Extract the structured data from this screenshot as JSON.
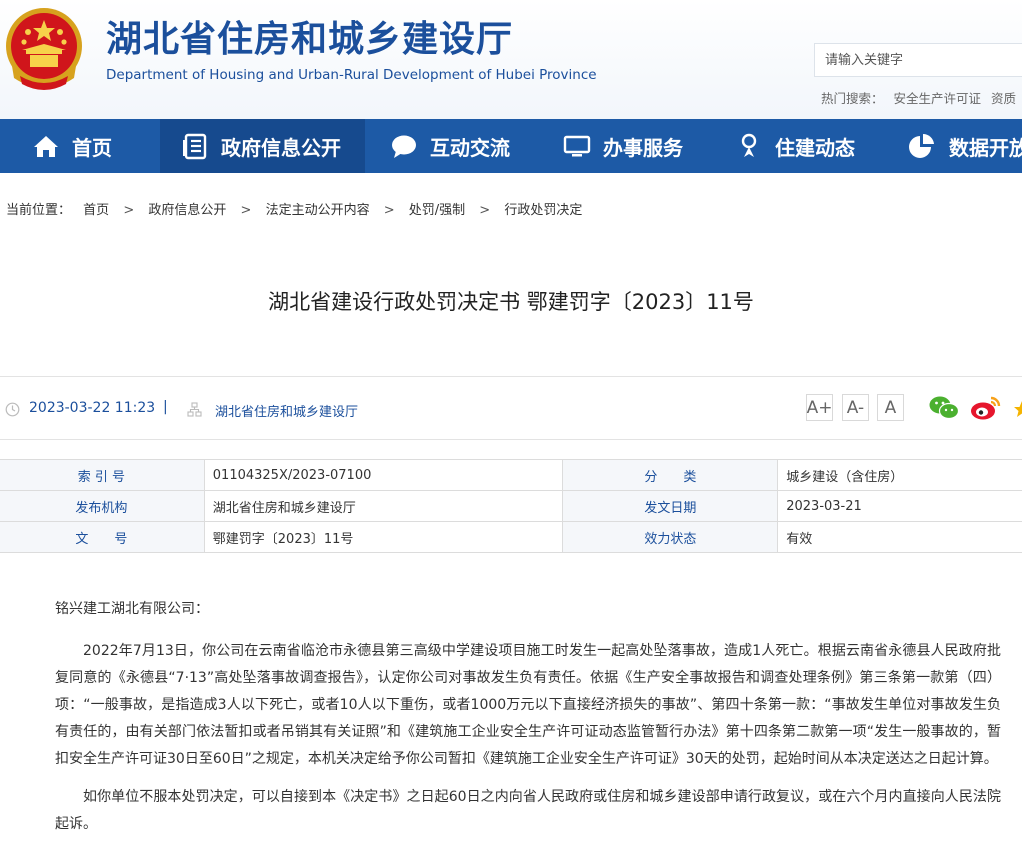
{
  "header": {
    "title": "湖北省住房和城乡建设厅",
    "subtitle": "Department of Housing and Urban-Rural Development of Hubei Province",
    "search_placeholder": "请输入关键字",
    "hot_label": "热门搜索：",
    "hot_items": [
      "安全生产许可证",
      "资质"
    ]
  },
  "nav": {
    "items": [
      {
        "label": "首页",
        "icon": "home-icon"
      },
      {
        "label": "政府信息公开",
        "icon": "document-icon",
        "active": true
      },
      {
        "label": "互动交流",
        "icon": "chat-icon"
      },
      {
        "label": "办事服务",
        "icon": "monitor-icon"
      },
      {
        "label": "住建动态",
        "icon": "person-icon"
      },
      {
        "label": "数据开放",
        "icon": "pie-chart-icon"
      }
    ]
  },
  "breadcrumb": {
    "label": "当前位置：",
    "items": [
      "首页",
      "政府信息公开",
      "法定主动公开内容",
      "处罚/强制",
      "行政处罚决定"
    ],
    "separator": ">"
  },
  "article": {
    "title": "湖北省建设行政处罚决定书 鄂建罚字〔2023〕11号",
    "date": "2023-03-22 11:23",
    "divider": "|",
    "source": "湖北省住房和城乡建设厅",
    "font_buttons": [
      "A+",
      "A-",
      "A"
    ]
  },
  "info": {
    "index_label": "索 引 号",
    "index_value": "01104325X/2023-07100",
    "category_label": "分　　类",
    "category_value": "城乡建设（含住房）",
    "issuer_label": "发布机构",
    "issuer_value": "湖北省住房和城乡建设厅",
    "issue_date_label": "发文日期",
    "issue_date_value": "2023-03-21",
    "docno_label": "文　　号",
    "docno_value": "鄂建罚字〔2023〕11号",
    "status_label": "效力状态",
    "status_value": "有效"
  },
  "content": {
    "salutation": "铭兴建工湖北有限公司：",
    "p1": "2022年7月13日，你公司在云南省临沧市永德县第三高级中学建设项目施工时发生一起高处坠落事故，造成1人死亡。根据云南省永德县人民政府批复同意的《永德县“7·13”高处坠落事故调查报告》，认定你公司对事故发生负有责任。依据《生产安全事故报告和调查处理条例》第三条第一款第（四）项：“一般事故，是指造成3人以下死亡，或者10人以下重伤，或者1000万元以下直接经济损失的事故”、第四十条第一款：“事故发生单位对事故发生负有责任的，由有关部门依法暂扣或者吊销其有关证照”和《建筑施工企业安全生产许可证动态监管暂行办法》第十四条第二款第一项“发生一般事故的，暂扣安全生产许可证30日至60日”之规定，本机关决定给予你公司暂扣《建筑施工企业安全生产许可证》30天的处罚，起始时间从本决定送达之日起计算。",
    "p2": "如你单位不服本处罚决定，可以自接到本《决定书》之日起60日之内向省人民政府或住房和城乡建设部申请行政复议，或在六个月内直接向人民法院起诉。"
  },
  "colors": {
    "brand_blue": "#1b4f9c",
    "nav_bg": "#1d5aa6",
    "nav_active": "#164a8e",
    "wechat": "#4bb02f",
    "weibo": "#e6162d"
  }
}
